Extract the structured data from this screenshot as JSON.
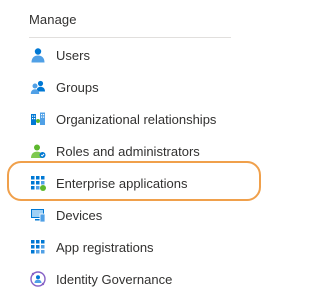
{
  "section": {
    "title": "Manage"
  },
  "items": [
    {
      "label": "Users",
      "icon": "user-icon"
    },
    {
      "label": "Groups",
      "icon": "groups-icon"
    },
    {
      "label": "Organizational relationships",
      "icon": "organizational-relationships-icon"
    },
    {
      "label": "Roles and administrators",
      "icon": "roles-icon"
    },
    {
      "label": "Enterprise applications",
      "icon": "enterprise-apps-icon",
      "highlighted": true
    },
    {
      "label": "Devices",
      "icon": "devices-icon"
    },
    {
      "label": "App registrations",
      "icon": "app-registrations-icon"
    },
    {
      "label": "Identity Governance",
      "icon": "identity-governance-icon"
    }
  ],
  "colors": {
    "highlight_border": "#f0a04b",
    "icon_blue": "#0078d4",
    "icon_green": "#5db82e"
  }
}
